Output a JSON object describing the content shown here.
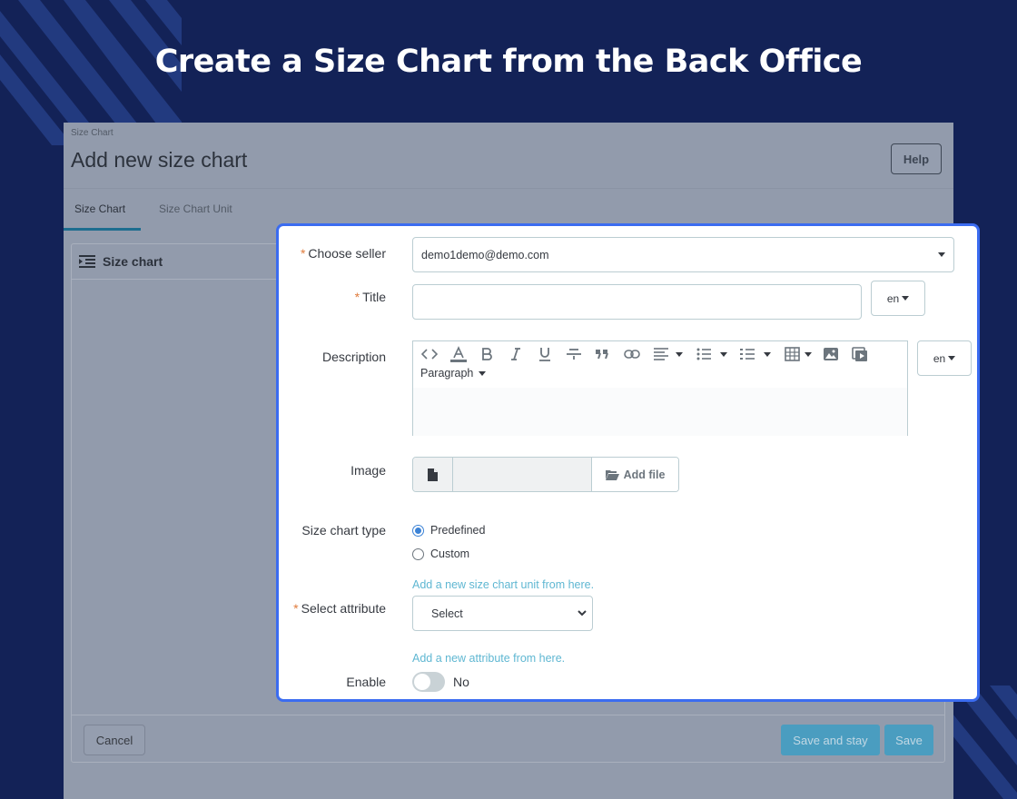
{
  "hero": {
    "title": "Create a Size Chart from the Back Office"
  },
  "backoffice": {
    "breadcrumb": "Size Chart",
    "page_title": "Add new size chart",
    "help_label": "Help",
    "tabs": [
      {
        "label": "Size Chart",
        "active": true
      },
      {
        "label": "Size Chart Unit",
        "active": false
      }
    ],
    "panel_title": "Size chart",
    "cancel_label": "Cancel",
    "save_stay_label": "Save and stay",
    "save_label": "Save"
  },
  "form": {
    "seller": {
      "label": "Choose seller",
      "required": "*",
      "value": "demo1demo@demo.com"
    },
    "title": {
      "label": "Title",
      "required": "*",
      "value": "",
      "lang": "en"
    },
    "description": {
      "label": "Description",
      "lang": "en",
      "format": "Paragraph",
      "toolbar_icons": [
        "code-icon",
        "font-color-icon",
        "bold-icon",
        "italic-icon",
        "underline-icon",
        "strikethrough-icon",
        "quote-icon",
        "link-icon",
        "align-icon",
        "bullet-list-icon",
        "numbered-list-icon",
        "table-icon",
        "image-icon",
        "video-icon"
      ]
    },
    "image": {
      "label": "Image",
      "add_file_label": "Add file"
    },
    "size_chart_type": {
      "label": "Size chart type",
      "options": [
        {
          "label": "Predefined",
          "selected": true
        },
        {
          "label": "Custom",
          "selected": false
        }
      ]
    },
    "unit_link": "Add a new size chart unit from here.",
    "attribute": {
      "label": "Select attribute",
      "required": "*",
      "value": "Select"
    },
    "attribute_link": "Add a new attribute from here.",
    "enable": {
      "label": "Enable",
      "state_label": "No",
      "on": false
    }
  },
  "colors": {
    "background": "#132257",
    "focus_border": "#3b6cf0",
    "required": "#e07b3c",
    "link": "#5fb7d2",
    "primary_button": "#4a9dc0"
  }
}
